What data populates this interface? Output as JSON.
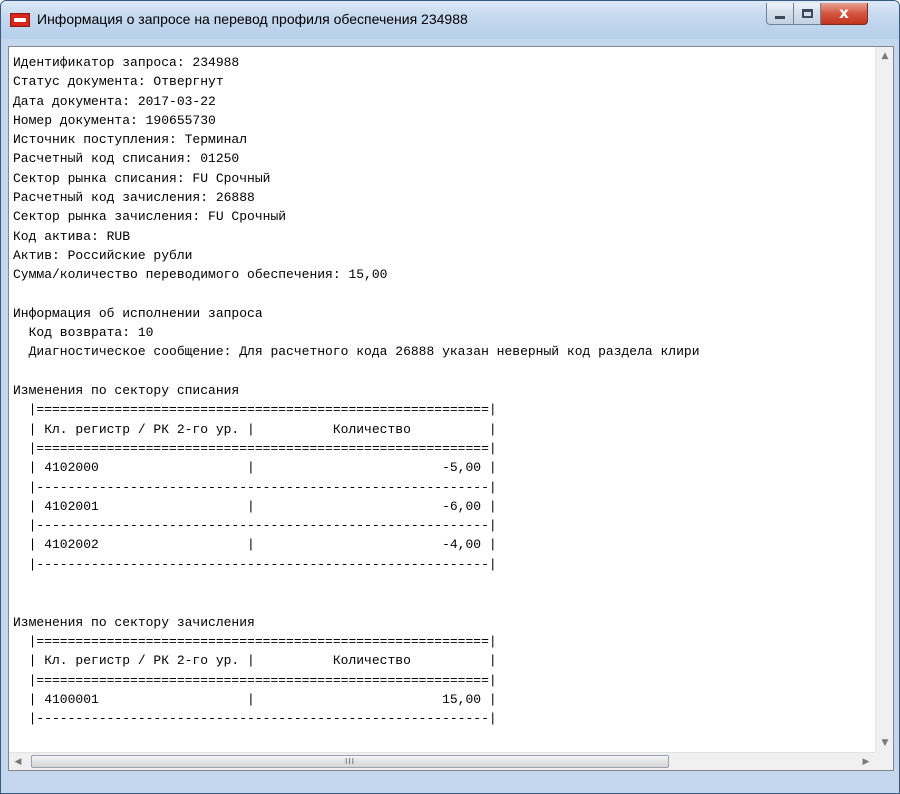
{
  "window": {
    "title": "Информация о запросе на перевод профиля обеспечения 234988",
    "icons": {
      "app": "app-icon",
      "minimize": "minimize-icon",
      "maximize": "maximize-icon",
      "close": "close-icon"
    },
    "close_glyph": "x"
  },
  "report": {
    "lines": [
      "Идентификатор запроса: 234988",
      "Статус документа: Отвергнут",
      "Дата документа: 2017-03-22",
      "Номер документа: 190655730",
      "Источник поступления: Терминал",
      "Расчетный код списания: 01250",
      "Сектор рынка списания: FU Срочный",
      "Расчетный код зачисления: 26888",
      "Сектор рынка зачисления: FU Срочный",
      "Код актива: RUB",
      "Актив: Российские рубли",
      "Сумма/количество переводимого обеспечения: 15,00",
      "",
      "Информация об исполнении запроса",
      "  Код возврата: 10",
      "  Диагностическое сообщение: Для расчетного кода 26888 указан неверный код раздела клири",
      "",
      "Изменения по сектору списания",
      "  |==========================================================|",
      "  | Кл. регистр / РК 2-го ур. |          Количество          |",
      "  |==========================================================|",
      "  | 4102000                   |                        -5,00 |",
      "  |----------------------------------------------------------|",
      "  | 4102001                   |                        -6,00 |",
      "  |----------------------------------------------------------|",
      "  | 4102002                   |                        -4,00 |",
      "  |----------------------------------------------------------|",
      "",
      "",
      "Изменения по сектору зачисления",
      "  |==========================================================|",
      "  | Кл. регистр / РК 2-го ур. |          Количество          |",
      "  |==========================================================|",
      "  | 4100001                   |                        15,00 |",
      "  |----------------------------------------------------------|"
    ]
  },
  "scrollbars": {
    "up_arrow": "▲",
    "down_arrow": "▼",
    "left_arrow": "◀",
    "right_arrow": "▶",
    "thumb_grip": "III"
  }
}
